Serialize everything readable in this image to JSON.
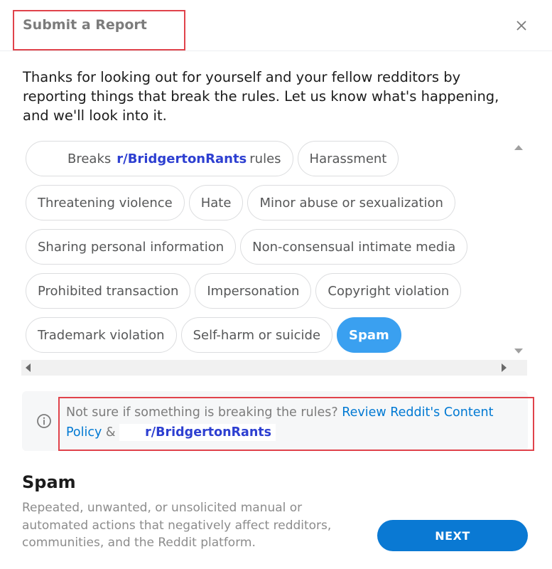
{
  "header": {
    "title": "Submit a Report",
    "close_icon": "close-icon"
  },
  "intro": "Thanks for looking out for yourself and your fellow redditors by reporting things that break the rules. Let us know what's happening, and we'll look into it.",
  "chips": {
    "rows": [
      [
        {
          "label_prefix": "Breaks",
          "subreddit": "r/BridgertonRants",
          "label_suffix": "rules",
          "selected": false
        },
        {
          "label": "Harassment",
          "selected": false
        }
      ],
      [
        {
          "label": "Threatening violence",
          "selected": false
        },
        {
          "label": "Hate",
          "selected": false
        },
        {
          "label": "Minor abuse or sexualization",
          "selected": false
        }
      ],
      [
        {
          "label": "Sharing personal information",
          "selected": false
        },
        {
          "label": "Non-consensual intimate media",
          "selected": false
        }
      ],
      [
        {
          "label": "Prohibited transaction",
          "selected": false
        },
        {
          "label": "Impersonation",
          "selected": false
        },
        {
          "label": "Copyright violation",
          "selected": false
        }
      ],
      [
        {
          "label": "Trademark violation",
          "selected": false
        },
        {
          "label": "Self-harm or suicide",
          "selected": false
        },
        {
          "label": "Spam",
          "selected": true
        }
      ]
    ]
  },
  "notice": {
    "icon": "info-icon",
    "text": "Not sure if something is breaking the rules?",
    "link1": "Review Reddit's Content Policy",
    "amp": "&",
    "subreddit": "r/BridgertonRants"
  },
  "selected_rule": {
    "title": "Spam",
    "description": "Repeated, unwanted, or unsolicited manual or automated actions that negatively affect redditors, communities, and the Reddit platform."
  },
  "next_label": "NEXT",
  "colors": {
    "accent": "#0a79d3",
    "selected_chip": "#3aa0f0",
    "subreddit_link": "#2d3fd1",
    "highlight_box": "#e0434b"
  }
}
